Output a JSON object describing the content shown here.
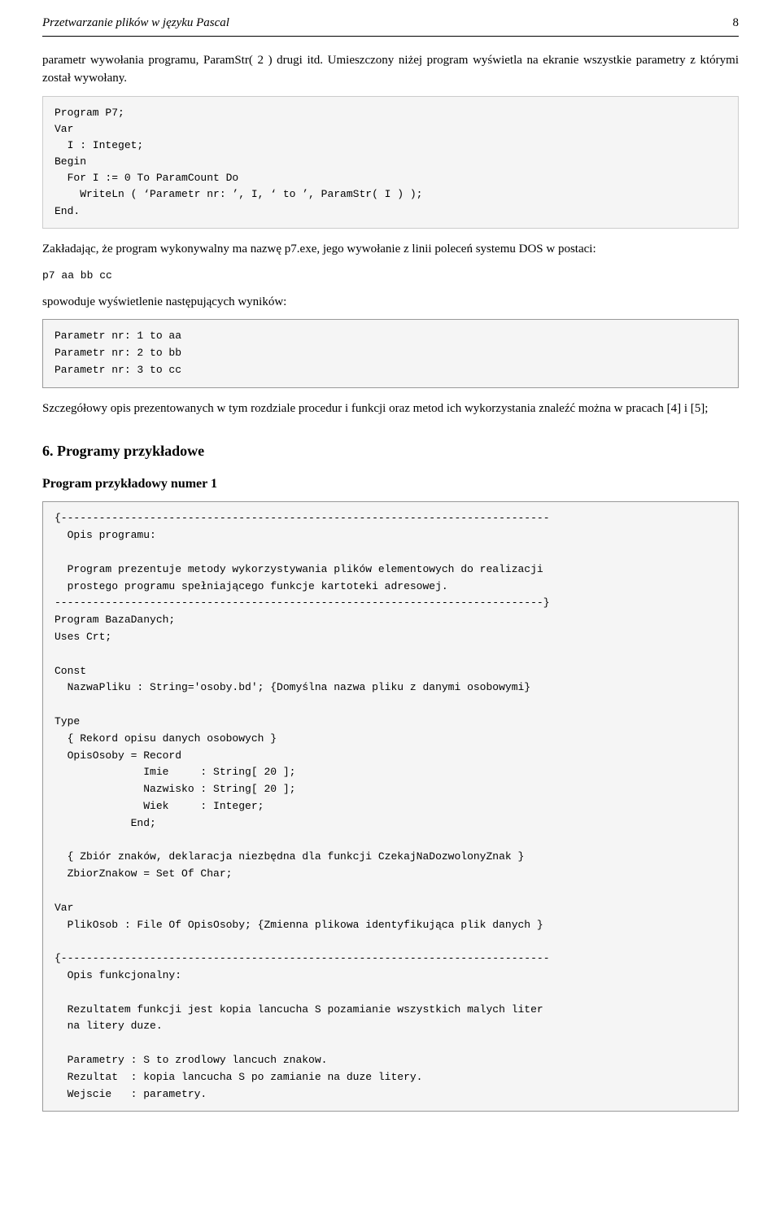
{
  "header": {
    "title": "Przetwarzanie plików w języku Pascal",
    "page_number": "8"
  },
  "intro_paragraph_1": "parametr wywołania programu, ParamStr( 2 ) drugi itd. Umieszczony niżej program wyświetla na ekranie wszystkie parametry z którymi został wywołany.",
  "code_block_1": "Program P7;\nVar\n  I : Integet;\nBegin\n  For I := 0 To ParamCount Do\n    WriteLn ( ‘Parametr nr: ’, I, ‘ to ’, ParamStr( I ) );\nEnd.",
  "paragraph_2": "Zakładając, że program wykonywalny ma nazwę p7.exe, jego wywołanie z linii poleceń systemu DOS w postaci:",
  "code_inline_1": "p7 aa bb cc",
  "paragraph_3": "spowoduje wyświetlenie następujących wyników:",
  "code_block_2": "Parametr nr: 1 to aa\nParametr nr: 2 to bb\nParametr nr: 3 to cc",
  "paragraph_4": "Szczegółowy opis prezentowanych w tym rozdziale procedur i funkcji oraz metod ich wykorzystania znaleźć można w pracach [4] i [5];",
  "section_6_title": "6. Programy przykładowe",
  "subsection_title": "Program przykładowy numer 1",
  "code_block_3": "{-----------------------------------------------------------------------------\n  Opis programu:\n\n  Program prezentuje metody wykorzystywania plików elementowych do realizacji\n  prostego programu spełniającego funkcje kartoteki adresowej.\n-----------------------------------------------------------------------------}\nProgram BazaDanych;\nUses Crt;\n\nConst\n  NazwaPliku : String='osoby.bd'; {Domyślna nazwa pliku z danymi osobowymi}\n\nType\n  { Rekord opisu danych osobowych }\n  OpisOsoby = Record\n              Imie     : String[ 20 ];\n              Nazwisko : String[ 20 ];\n              Wiek     : Integer;\n            End;\n\n  { Zbiór znaków, deklaracja niezbędna dla funkcji CzekajNaDozwolonyZnak }\n  ZbiorZnakow = Set Of Char;\n\nVar\n  PlikOsob : File Of OpisOsoby; {Zmienna plikowa identyfikująca plik danych }\n\n{-----------------------------------------------------------------------------\n  Opis funkcjonalny:\n\n  Rezultatem funkcji jest kopia lancucha S pozamianie wszystkich malych liter\n  na litery duze.\n\n  Parametry : S to zrodlowy lancuch znakow.\n  Rezultat  : kopia lancucha S po zamianie na duze litery.\n  Wejscie   : parametry."
}
